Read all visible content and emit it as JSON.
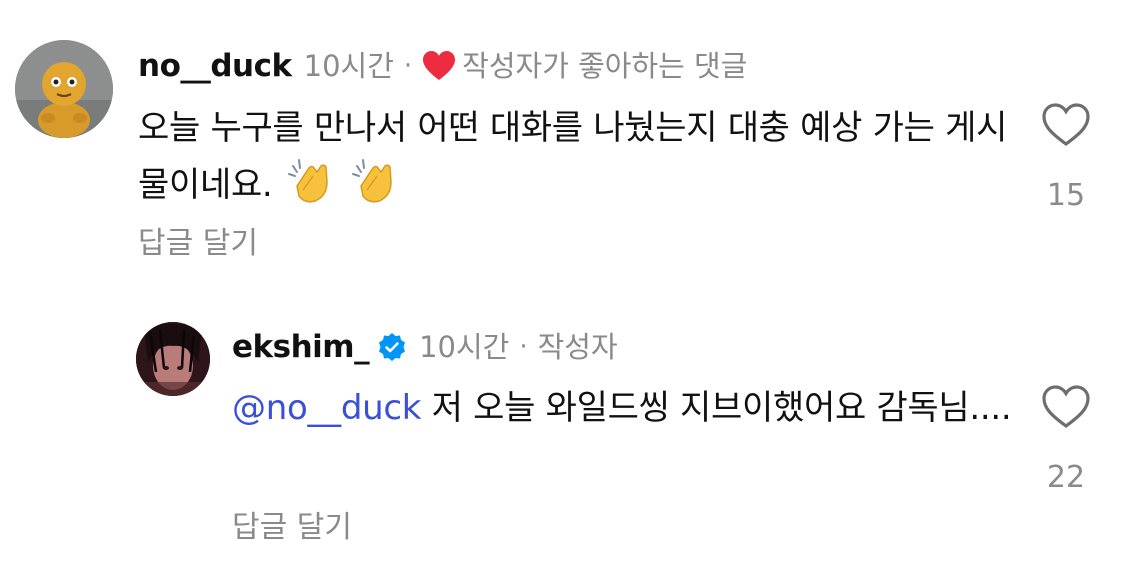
{
  "comments": [
    {
      "username": "no__duck",
      "time": "10시간",
      "separator": "·",
      "liked_by_author": "작성자가 좋아하는 댓글",
      "text": "오늘 누구를 만나서 어떤 대화를 나눴는지 대충 예상 가는 게시물이네요.",
      "emojis": [
        "clapping-hands",
        "clapping-hands"
      ],
      "reply_label": "답글 달기",
      "likes": "15",
      "avatar_icon": "cartoon-figure-avatar"
    },
    {
      "username": "ekshim_",
      "verified": true,
      "time": "10시간",
      "separator": "·",
      "author_label": "작성자",
      "mention": "@no__duck",
      "text": " 저 오늘 와일드씽 지브이했어요 감독님....",
      "reply_label": "답글 달기",
      "likes": "22",
      "avatar_icon": "profile-photo-avatar"
    }
  ],
  "colors": {
    "mention": "#3b4fd8",
    "heart_red": "#ed2d3f",
    "verified_blue": "#0095f6",
    "secondary_text": "#8a8a8a"
  }
}
